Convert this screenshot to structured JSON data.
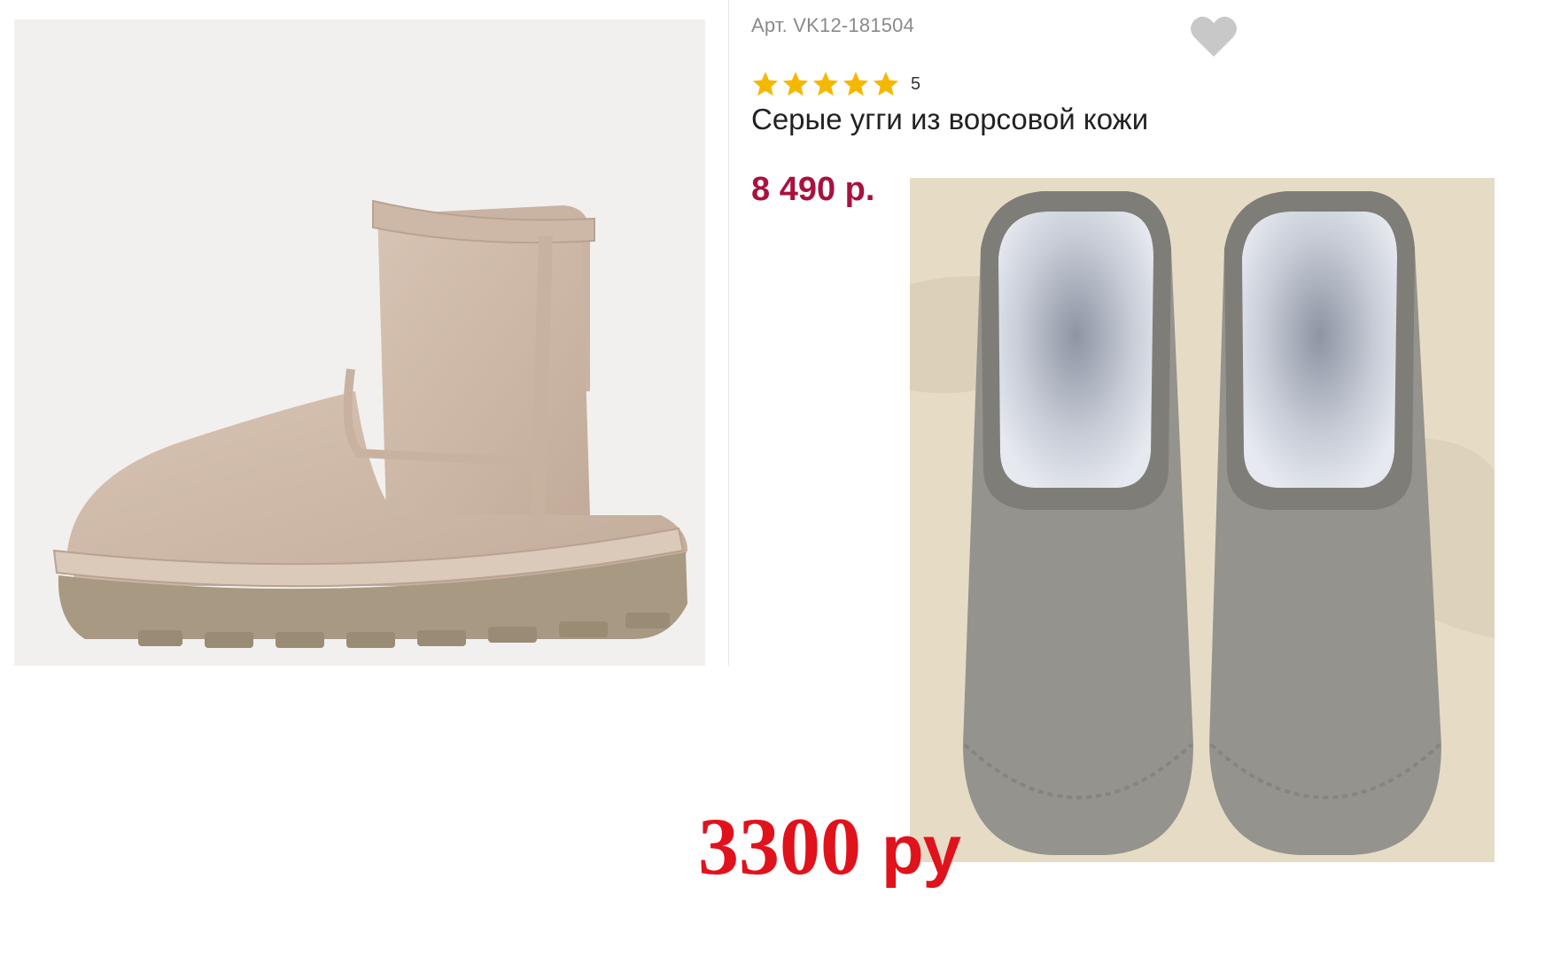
{
  "product": {
    "sku": "Арт. VK12-181504",
    "rating": 5,
    "rating_label": "5",
    "title": "Серые угги из ворсовой кожи",
    "price": "8 490 р."
  },
  "promo": {
    "price_value": "3300",
    "price_unit": "ру"
  },
  "icons": {
    "favorite": "heart-icon",
    "star": "star-icon"
  },
  "colors": {
    "price": "#a8123e",
    "promo": "#e0121b",
    "star": "#f5b800",
    "heart": "#c8c8c8"
  }
}
